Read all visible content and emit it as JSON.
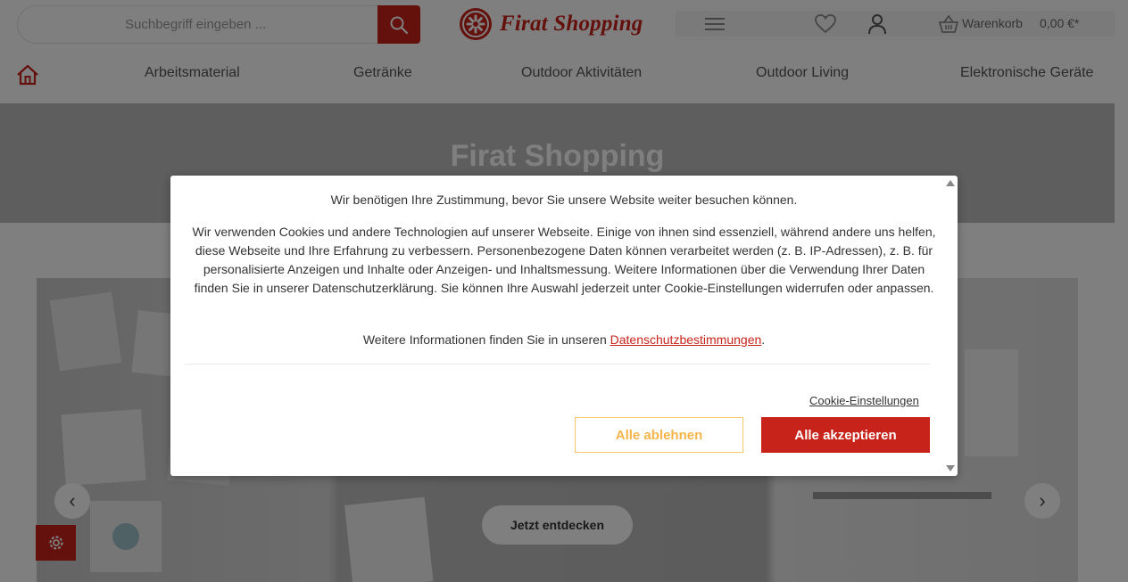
{
  "header": {
    "search": {
      "placeholder": "Suchbegriff eingeben ..."
    },
    "logo_text": "Firat Shopping",
    "cart": {
      "label": "Warenkorb",
      "total": "0,00 €*"
    }
  },
  "nav": {
    "items": [
      {
        "label": "Arbeitsmaterial"
      },
      {
        "label": "Getränke"
      },
      {
        "label": "Outdoor Aktivitäten"
      },
      {
        "label": "Outdoor Living"
      },
      {
        "label": "Elektronische Geräte"
      }
    ]
  },
  "hero": {
    "title": "Firat Shopping",
    "cta_label": "Jetzt entdecken",
    "prev_glyph": "‹",
    "next_glyph": "›"
  },
  "cookie_modal": {
    "intro": "Wir benötigen Ihre Zustimmung, bevor Sie unsere Website weiter besuchen können.",
    "body": "Wir verwenden Cookies und andere Technologien auf unserer Webseite. Einige von ihnen sind essenziell, während andere uns helfen, diese Webseite und Ihre Erfahrung zu verbessern. Personenbezogene Daten können verarbeitet werden (z. B. IP-Adressen), z. B. für personalisierte Anzeigen und Inhalte oder Anzeigen- und Inhaltsmessung. Weitere Informationen über die Verwendung Ihrer Daten finden Sie in unserer Datenschutzerklärung. Sie können Ihre Auswahl jederzeit unter Cookie-Einstellungen widerrufen oder anpassen.",
    "more_info_prefix": "Weitere Informationen finden Sie in unseren ",
    "more_info_link": "Datenschutzbestimmungen",
    "more_info_suffix": ".",
    "settings_link": "Cookie-Einstellungen",
    "decline_label": "Alle ablehnen",
    "accept_label": "Alle akzeptieren"
  },
  "colors": {
    "brand_red": "#c8231b",
    "decline_orange": "#f5b44a"
  }
}
